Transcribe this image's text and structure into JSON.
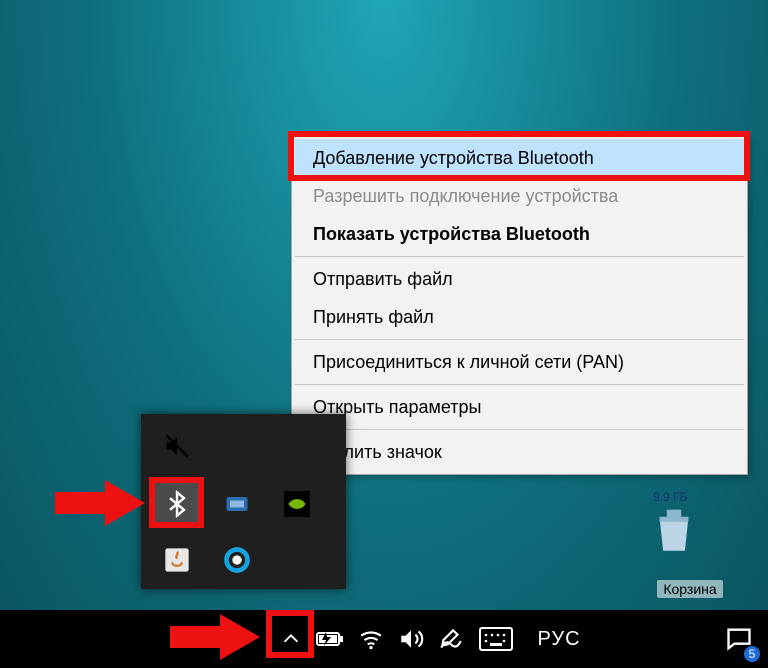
{
  "context_menu": {
    "items": [
      {
        "label": "Добавление устройства Bluetooth",
        "state": "hover"
      },
      {
        "label": "Разрешить подключение устройства",
        "state": "disabled"
      },
      {
        "label": "Показать устройства Bluetooth",
        "state": "bold"
      },
      {
        "sep": true
      },
      {
        "label": "Отправить файл",
        "state": ""
      },
      {
        "label": "Принять файл",
        "state": ""
      },
      {
        "sep": true
      },
      {
        "label": "Присоединиться к личной сети (PAN)",
        "state": ""
      },
      {
        "sep": true
      },
      {
        "label": "Открыть параметры",
        "state": ""
      },
      {
        "sep": true
      },
      {
        "label": "Удалить значок",
        "state": ""
      }
    ]
  },
  "tray_flyout": {
    "icons": [
      {
        "name": "volume-muted-icon",
        "row": 0,
        "col": 0
      },
      {
        "name": "bluetooth-icon",
        "row": 1,
        "col": 0,
        "selected": true
      },
      {
        "name": "hardware-icon",
        "row": 1,
        "col": 1
      },
      {
        "name": "nvidia-icon",
        "row": 1,
        "col": 2
      },
      {
        "name": "java-icon",
        "row": 2,
        "col": 0
      },
      {
        "name": "cortana-icon",
        "row": 2,
        "col": 1
      }
    ]
  },
  "recycle_bin": {
    "label": "Корзина",
    "disk_text": "9,9 ГБ"
  },
  "taskbar": {
    "language": "РУС",
    "notification_count": "5"
  }
}
